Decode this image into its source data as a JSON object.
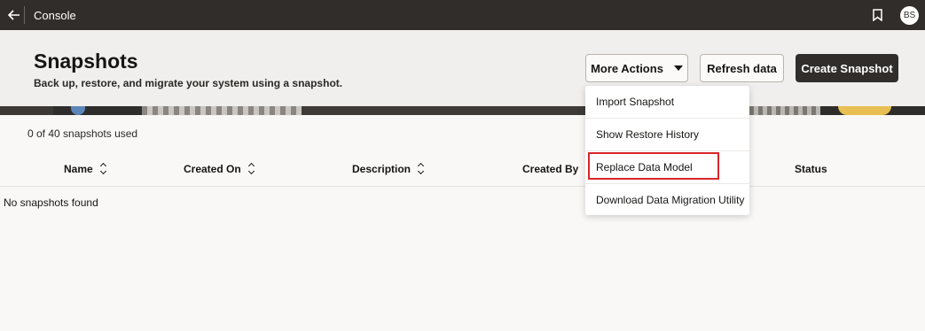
{
  "topbar": {
    "title": "Console",
    "avatar_initials": "BS",
    "icons": {
      "back": "arrow-left-icon",
      "bookmark": "bookmark-icon"
    }
  },
  "header": {
    "title": "Snapshots",
    "subtitle": "Back up, restore, and migrate your system using a snapshot.",
    "buttons": {
      "more_actions": "More Actions",
      "refresh": "Refresh data",
      "create": "Create Snapshot"
    }
  },
  "more_actions_menu": {
    "items": [
      "Import Snapshot",
      "Show Restore History",
      "Replace Data Model",
      "Download Data Migration Utility"
    ],
    "highlighted_item": "Replace Data Model"
  },
  "table": {
    "usage_text": "0 of 40 snapshots used",
    "columns": [
      "Name",
      "Created On",
      "Description",
      "Created By",
      "Status"
    ],
    "empty_message": "No snapshots found"
  },
  "colors": {
    "topbar": "#312d2a",
    "primary_button": "#312d2a",
    "highlight_border": "#d8262a",
    "header_background": "#f1efed"
  }
}
